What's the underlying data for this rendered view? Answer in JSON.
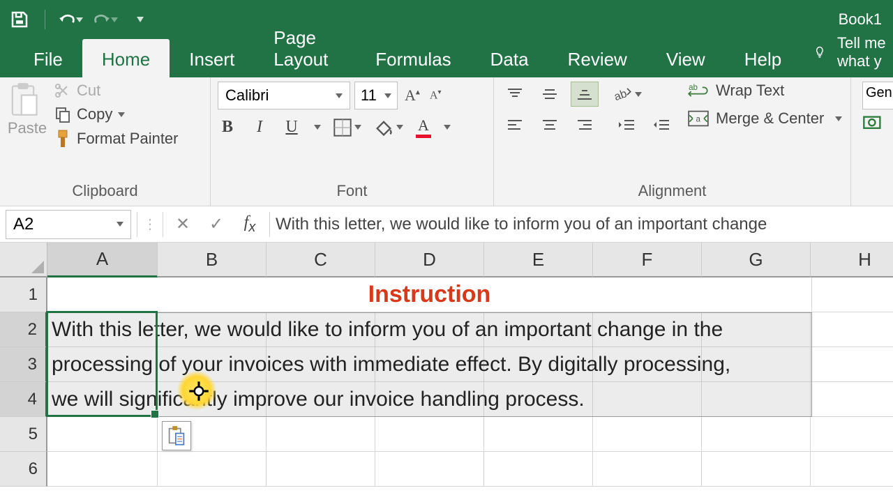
{
  "titlebar": {
    "book": "Book1"
  },
  "tabs": {
    "file": "File",
    "home": "Home",
    "insert": "Insert",
    "page_layout": "Page Layout",
    "formulas": "Formulas",
    "data": "Data",
    "review": "Review",
    "view": "View",
    "help": "Help",
    "tell_me": "Tell me what y"
  },
  "ribbon": {
    "clipboard": {
      "paste": "Paste",
      "cut": "Cut",
      "copy": "Copy",
      "format_painter": "Format Painter",
      "label": "Clipboard"
    },
    "font": {
      "name": "Calibri",
      "size": "11",
      "label": "Font"
    },
    "alignment": {
      "wrap": "Wrap Text",
      "merge": "Merge & Center",
      "label": "Alignment"
    },
    "number": {
      "format": "Gen"
    }
  },
  "formula_bar": {
    "name_box": "A2",
    "text": "With this letter, we would like to inform you of an important change"
  },
  "grid": {
    "cols": [
      "A",
      "B",
      "C",
      "D",
      "E",
      "F",
      "G",
      "H"
    ],
    "rows": [
      "1",
      "2",
      "3",
      "4",
      "5",
      "6"
    ],
    "title": "Instruction",
    "line1": "With this letter, we would like to inform you of an important change in the",
    "line2": "processing of your invoices with immediate effect. By digitally processing,",
    "line3": "we will significantly improve our invoice handling process."
  }
}
